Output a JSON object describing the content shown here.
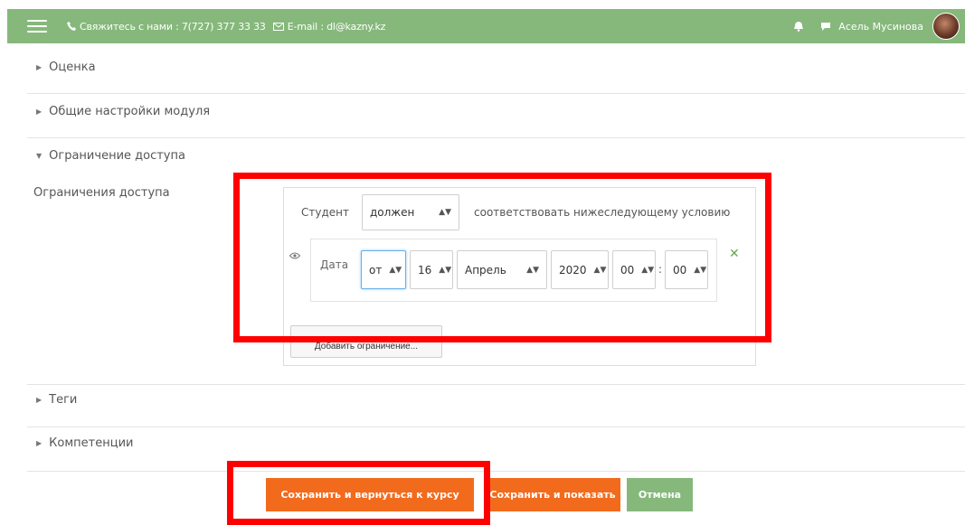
{
  "topbar": {
    "contact_text": "Свяжитесь с нами : 7(727) 377 33 33",
    "email_text": "E-mail : dl@kazny.kz",
    "user_name": "Асель Мусинова"
  },
  "sections": {
    "grade": "Оценка",
    "common_settings": "Общие настройки модуля",
    "access_restriction": "Ограничение доступа",
    "tags": "Теги",
    "competencies": "Компетенции"
  },
  "restrictions": {
    "label": "Ограничения доступа",
    "student_label": "Студент",
    "must_select": "должен",
    "match_text": "соответствовать нижеследующему условию",
    "condition": {
      "type_label": "Дата",
      "direction": "от",
      "day": "16",
      "month": "Апрель",
      "year": "2020",
      "hour": "00",
      "minute": "00"
    },
    "add_button": "Добавить ограничение..."
  },
  "buttons": {
    "save_return": "Сохранить и вернуться к курсу",
    "save_show": "Сохранить и показать",
    "cancel": "Отмена"
  },
  "colors": {
    "topbar": "#86b87c",
    "primary_button": "#f26b1d",
    "cancel_button": "#86b87c",
    "highlight": "#ff0000"
  }
}
